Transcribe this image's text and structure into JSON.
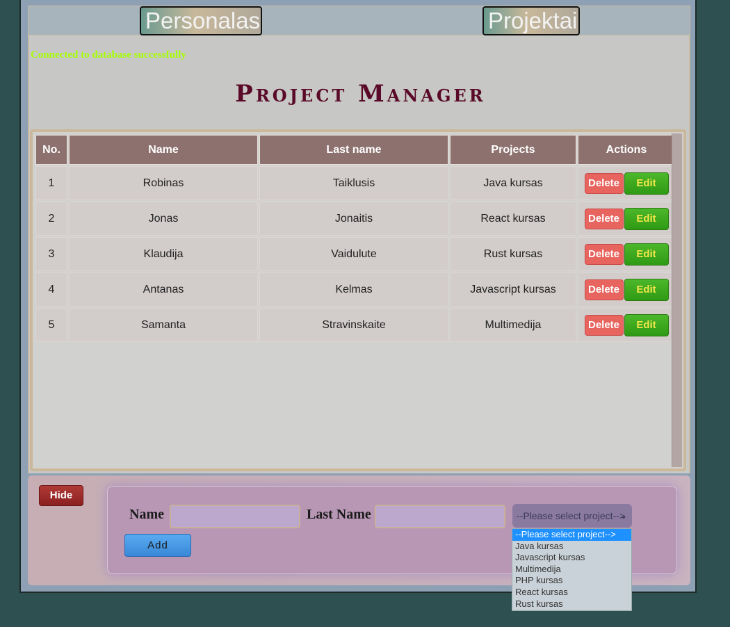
{
  "nav": {
    "personalas": "Personalas",
    "projektai": "Projektai"
  },
  "status_message": "Connected to database successfully",
  "page_title": "Project Manager",
  "table": {
    "headers": [
      "No.",
      "Name",
      "Last name",
      "Projects",
      "Actions"
    ],
    "rows": [
      {
        "no": "1",
        "name": "Robinas",
        "last": "Taiklusis",
        "project": "Java kursas"
      },
      {
        "no": "2",
        "name": "Jonas",
        "last": "Jonaitis",
        "project": "React kursas"
      },
      {
        "no": "3",
        "name": "Klaudija",
        "last": "Vaidulute",
        "project": "Rust kursas"
      },
      {
        "no": "4",
        "name": "Antanas",
        "last": "Kelmas",
        "project": "Javascript kursas"
      },
      {
        "no": "5",
        "name": "Samanta",
        "last": "Stravinskaite",
        "project": "Multimedija"
      }
    ],
    "delete_label": "Delete",
    "edit_label": "Edit"
  },
  "form": {
    "hide_label": "Hide",
    "name_label": "Name",
    "last_name_label": "Last Name",
    "select_value": "--Please select project-->",
    "add_label": "Add",
    "options": [
      "--Please select project-->",
      "Java kursas",
      "Javascript kursas",
      "Multimedija",
      "PHP kursas",
      "React kursas",
      "Rust kursas"
    ]
  },
  "colors": {
    "accent_title": "#5a0a28",
    "status_text": "#a5ff00",
    "delete": "#e8645e",
    "edit": "#3aa81c"
  }
}
